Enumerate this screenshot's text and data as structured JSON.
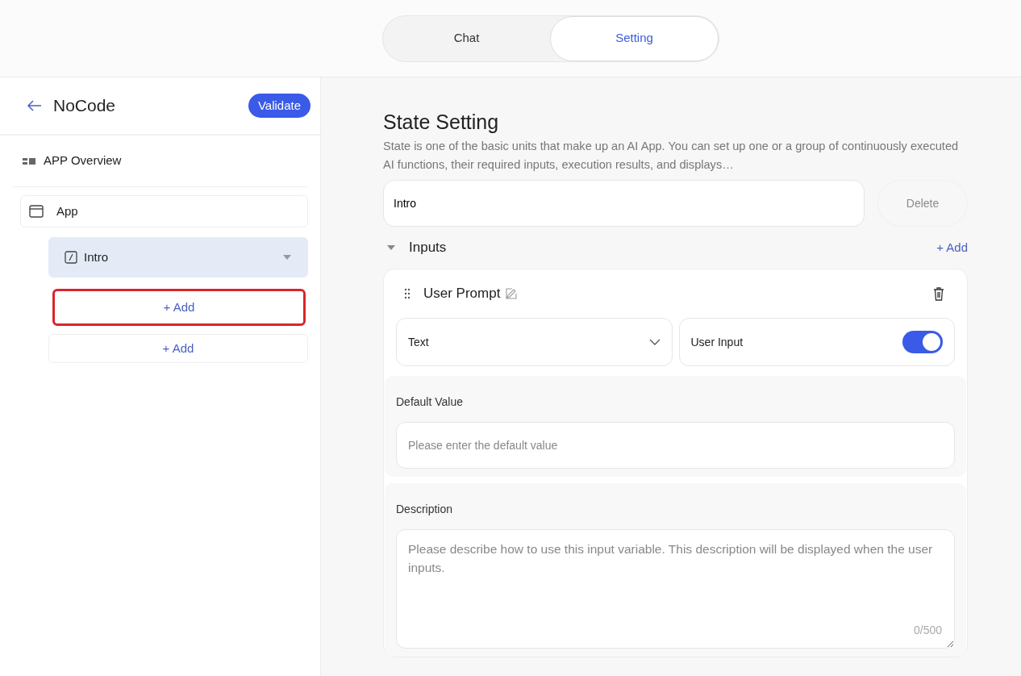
{
  "tabs": [
    {
      "label": "Chat",
      "selected": false
    },
    {
      "label": "Setting",
      "selected": true
    }
  ],
  "sidebar": {
    "title": "NoCode",
    "validate_button": "Validate",
    "overview": "APP Overview",
    "tree": {
      "label": "App",
      "children": [
        {
          "label": "Intro",
          "selected": true,
          "expanded": true
        }
      ]
    },
    "add_buttons": [
      {
        "label": "+ Add",
        "highlighted": true
      },
      {
        "label": "+ Add",
        "highlighted": false
      }
    ]
  },
  "main": {
    "title": "State Setting",
    "description": "State is one of the basic units that make up an AI App. You can set up one or a group of continuously executed AI functions, their required inputs, execution results, and displays…",
    "state_name": "Intro",
    "delete_button": {
      "label": "Delete",
      "disabled": true
    },
    "inputs": {
      "label": "Inputs",
      "expanded": true,
      "add_link": "+ Add",
      "items": [
        {
          "name": "User Prompt",
          "type": "Text",
          "toggle_label": "User Input",
          "on": true,
          "default_label": "Default Value",
          "default_placeholder": "Please enter the default value",
          "description_label": "Description",
          "description_placeholder": "Please describe how to use this input variable. This description will be displayed when the user inputs.",
          "counter": "0/500"
        }
      ]
    }
  }
}
